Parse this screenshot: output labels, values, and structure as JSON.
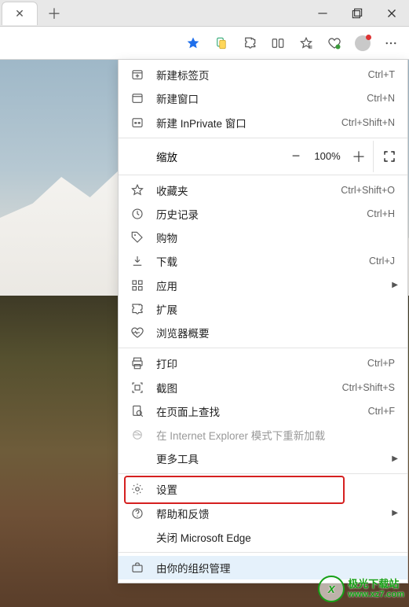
{
  "toolbar": {
    "icons": {
      "favorite": "favorite-star-icon",
      "collections": "collections-icon",
      "extensions": "extensions-icon",
      "split": "split-screen-icon",
      "favorites_list": "favorites-list-icon",
      "performance": "performance-icon",
      "profile": "profile-icon",
      "more": "more-icon"
    }
  },
  "window_controls": {
    "minimize": "—",
    "maximize": "❐",
    "close": "✕"
  },
  "menu": {
    "new_tab": {
      "label": "新建标签页",
      "shortcut": "Ctrl+T"
    },
    "new_window": {
      "label": "新建窗口",
      "shortcut": "Ctrl+N"
    },
    "new_inprivate": {
      "label": "新建 InPrivate 窗口",
      "shortcut": "Ctrl+Shift+N"
    },
    "zoom": {
      "label": "缩放",
      "percent": "100%"
    },
    "favorites": {
      "label": "收藏夹",
      "shortcut": "Ctrl+Shift+O"
    },
    "history": {
      "label": "历史记录",
      "shortcut": "Ctrl+H"
    },
    "shopping": {
      "label": "购物"
    },
    "downloads": {
      "label": "下载",
      "shortcut": "Ctrl+J"
    },
    "apps": {
      "label": "应用"
    },
    "extensions": {
      "label": "扩展"
    },
    "browser_essentials": {
      "label": "浏览器概要"
    },
    "print": {
      "label": "打印",
      "shortcut": "Ctrl+P"
    },
    "screenshot": {
      "label": "截图",
      "shortcut": "Ctrl+Shift+S"
    },
    "find": {
      "label": "在页面上查找",
      "shortcut": "Ctrl+F"
    },
    "ie_mode": {
      "label": "在 Internet Explorer 模式下重新加载"
    },
    "more_tools": {
      "label": "更多工具"
    },
    "settings": {
      "label": "设置"
    },
    "help": {
      "label": "帮助和反馈"
    },
    "close_edge": {
      "label": "关闭 Microsoft Edge"
    },
    "managed": {
      "label": "由你的组织管理"
    }
  },
  "watermark": {
    "name": "极光下载站",
    "url": "www.xz7.com"
  }
}
